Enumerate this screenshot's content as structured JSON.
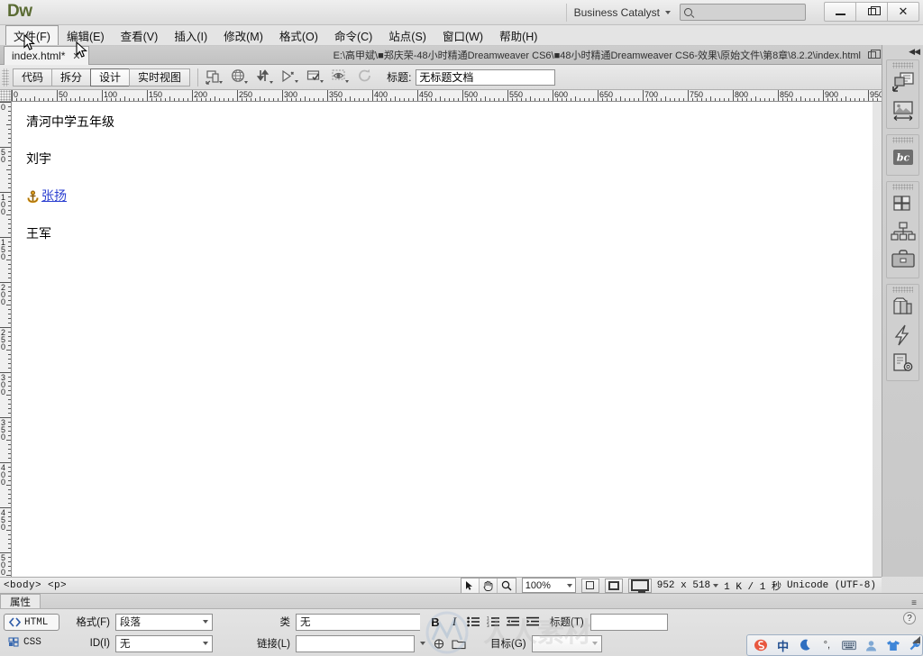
{
  "titlebar": {
    "logo": "Dw",
    "workspace": "Business Catalyst",
    "search_placeholder": "",
    "search_value": "",
    "minimize": "—",
    "restore": "❐",
    "close": "✕"
  },
  "menubar": {
    "items": [
      {
        "label": "文件(F)",
        "active": true
      },
      {
        "label": "编辑(E)",
        "active": false
      },
      {
        "label": "查看(V)",
        "active": false
      },
      {
        "label": "插入(I)",
        "active": false
      },
      {
        "label": "修改(M)",
        "active": false
      },
      {
        "label": "格式(O)",
        "active": false
      },
      {
        "label": "命令(C)",
        "active": false
      },
      {
        "label": "站点(S)",
        "active": false
      },
      {
        "label": "窗口(W)",
        "active": false
      },
      {
        "label": "帮助(H)",
        "active": false
      }
    ]
  },
  "doctab": {
    "filename": "index.html*",
    "close": "✕",
    "filepath": "E:\\高甲斌\\■郑庆荣-48小时精通Dreamweaver CS6\\■48小时精通Dreamweaver CS6-效果\\原始文件\\第8章\\8.2.2\\index.html"
  },
  "toolbar": {
    "views": [
      {
        "label": "代码",
        "selected": false
      },
      {
        "label": "拆分",
        "selected": false
      },
      {
        "label": "设计",
        "selected": true
      },
      {
        "label": "实时视图",
        "selected": false
      }
    ],
    "icons": [
      "multiscreen-icon",
      "preview-browser-icon",
      "file-management-icon",
      "code-navigation-icon",
      "visual-aids-icon",
      "live-view-options-icon",
      "refresh-icon"
    ],
    "title_label": "标题:",
    "title_value": "无标题文档"
  },
  "rulers": {
    "h_labels": [
      0,
      50,
      100,
      150,
      200,
      250,
      300,
      350,
      400,
      450,
      500,
      550,
      600,
      650,
      700,
      750,
      800,
      850,
      900,
      950
    ],
    "v_labels": [
      0,
      50,
      100,
      150,
      200,
      250,
      300,
      350,
      400,
      450,
      500
    ],
    "unit_step": 50
  },
  "document": {
    "paragraphs": [
      {
        "text": "清河中学五年级",
        "type": "text"
      },
      {
        "text": "刘宇",
        "type": "text"
      },
      {
        "text": "张扬",
        "type": "anchor-link"
      },
      {
        "text": "王军",
        "type": "text"
      }
    ],
    "link_color": "#2b3fd0"
  },
  "dock": {
    "collapse": "◀◀",
    "groups": [
      {
        "icons": [
          "insert-panel-icon",
          "image-size-icon"
        ]
      },
      {
        "icons": [
          "business-catalyst-icon"
        ]
      },
      {
        "icons": [
          "css-styles-icon",
          "site-map-icon",
          "business-icon"
        ]
      },
      {
        "icons": [
          "databases-icon",
          "bindings-icon",
          "server-behaviors-icon"
        ]
      }
    ]
  },
  "statusbar": {
    "tag_selector": "<body> <p>",
    "tools": [
      "select-tool-icon",
      "hand-tool-icon",
      "zoom-tool-icon"
    ],
    "zoom": "100%",
    "window_sizes": [
      "small-window-icon",
      "medium-window-icon",
      "large-window-icon"
    ],
    "dimensions": "952 x 518",
    "download": "1 K / 1 秒",
    "encoding": "Unicode (UTF-8)"
  },
  "properties": {
    "tab_label": "属性",
    "html_button": "HTML",
    "css_button": "CSS",
    "format_label": "格式(F)",
    "format_value": "段落",
    "id_label": "ID(I)",
    "id_value": "无",
    "class_label": "类",
    "class_value": "无",
    "link_label": "链接(L)",
    "link_value": "",
    "bold": "B",
    "italic": "I",
    "title_label": "标题(T)",
    "title_value": "",
    "target_label": "目标(G)",
    "target_value": "",
    "help": "?"
  },
  "ime": {
    "items": [
      "sogou-logo-icon",
      "中",
      "moon-icon",
      "degree-icon",
      "keyboard-icon",
      "user-icon",
      "skin-icon",
      "tools-icon"
    ]
  }
}
